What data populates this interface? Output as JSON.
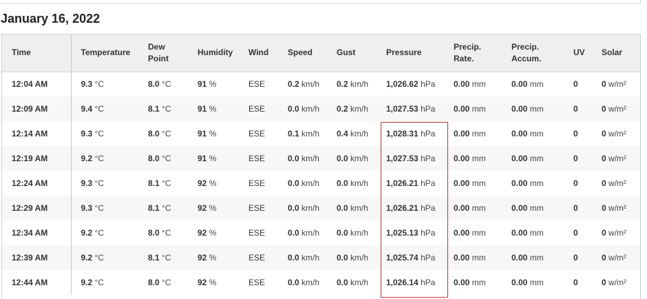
{
  "page": {
    "title": "January 16, 2022"
  },
  "table": {
    "headers": {
      "time": "Time",
      "temperature": "Temperature",
      "dew_point": [
        "Dew",
        "Point"
      ],
      "humidity": "Humidity",
      "wind": "Wind",
      "speed": "Speed",
      "gust": "Gust",
      "pressure": "Pressure",
      "precip_rate": [
        "Precip.",
        "Rate."
      ],
      "precip_accum": [
        "Precip.",
        "Accum."
      ],
      "uv": "UV",
      "solar": "Solar"
    },
    "units": {
      "temperature": "°C",
      "dew_point": "°C",
      "humidity": "%",
      "speed": "km/h",
      "gust": "km/h",
      "pressure": "hPa",
      "precip_rate": "mm",
      "precip_accum": "mm",
      "solar": "w/m²"
    },
    "rows": [
      {
        "time": "12:04 AM",
        "temperature": "9.3",
        "dew_point": "8.0",
        "humidity": "91",
        "wind": "ESE",
        "speed": "0.2",
        "gust": "0.2",
        "pressure": "1,026.62",
        "precip_rate": "0.00",
        "precip_accum": "0.00",
        "uv": "0",
        "solar": "0"
      },
      {
        "time": "12:09 AM",
        "temperature": "9.4",
        "dew_point": "8.1",
        "humidity": "91",
        "wind": "ESE",
        "speed": "0.0",
        "gust": "0.2",
        "pressure": "1,027.53",
        "precip_rate": "0.00",
        "precip_accum": "0.00",
        "uv": "0",
        "solar": "0"
      },
      {
        "time": "12:14 AM",
        "temperature": "9.3",
        "dew_point": "8.0",
        "humidity": "91",
        "wind": "ESE",
        "speed": "0.1",
        "gust": "0.4",
        "pressure": "1,028.31",
        "precip_rate": "0.00",
        "precip_accum": "0.00",
        "uv": "0",
        "solar": "0"
      },
      {
        "time": "12:19 AM",
        "temperature": "9.2",
        "dew_point": "8.0",
        "humidity": "91",
        "wind": "ESE",
        "speed": "0.0",
        "gust": "0.0",
        "pressure": "1,027.53",
        "precip_rate": "0.00",
        "precip_accum": "0.00",
        "uv": "0",
        "solar": "0"
      },
      {
        "time": "12:24 AM",
        "temperature": "9.3",
        "dew_point": "8.1",
        "humidity": "92",
        "wind": "ESE",
        "speed": "0.0",
        "gust": "0.0",
        "pressure": "1,026.21",
        "precip_rate": "0.00",
        "precip_accum": "0.00",
        "uv": "0",
        "solar": "0"
      },
      {
        "time": "12:29 AM",
        "temperature": "9.3",
        "dew_point": "8.1",
        "humidity": "92",
        "wind": "ESE",
        "speed": "0.0",
        "gust": "0.0",
        "pressure": "1,026.21",
        "precip_rate": "0.00",
        "precip_accum": "0.00",
        "uv": "0",
        "solar": "0"
      },
      {
        "time": "12:34 AM",
        "temperature": "9.2",
        "dew_point": "8.0",
        "humidity": "92",
        "wind": "ESE",
        "speed": "0.0",
        "gust": "0.0",
        "pressure": "1,025.13",
        "precip_rate": "0.00",
        "precip_accum": "0.00",
        "uv": "0",
        "solar": "0"
      },
      {
        "time": "12:39 AM",
        "temperature": "9.2",
        "dew_point": "8.1",
        "humidity": "92",
        "wind": "ESE",
        "speed": "0.0",
        "gust": "0.0",
        "pressure": "1,025.74",
        "precip_rate": "0.00",
        "precip_accum": "0.00",
        "uv": "0",
        "solar": "0"
      },
      {
        "time": "12:44 AM",
        "temperature": "9.2",
        "dew_point": "8.0",
        "humidity": "92",
        "wind": "ESE",
        "speed": "0.0",
        "gust": "0.0",
        "pressure": "1,026.14",
        "precip_rate": "0.00",
        "precip_accum": "0.00",
        "uv": "0",
        "solar": "0"
      }
    ]
  },
  "highlight": {
    "column": "pressure",
    "color": "#b1363b"
  }
}
